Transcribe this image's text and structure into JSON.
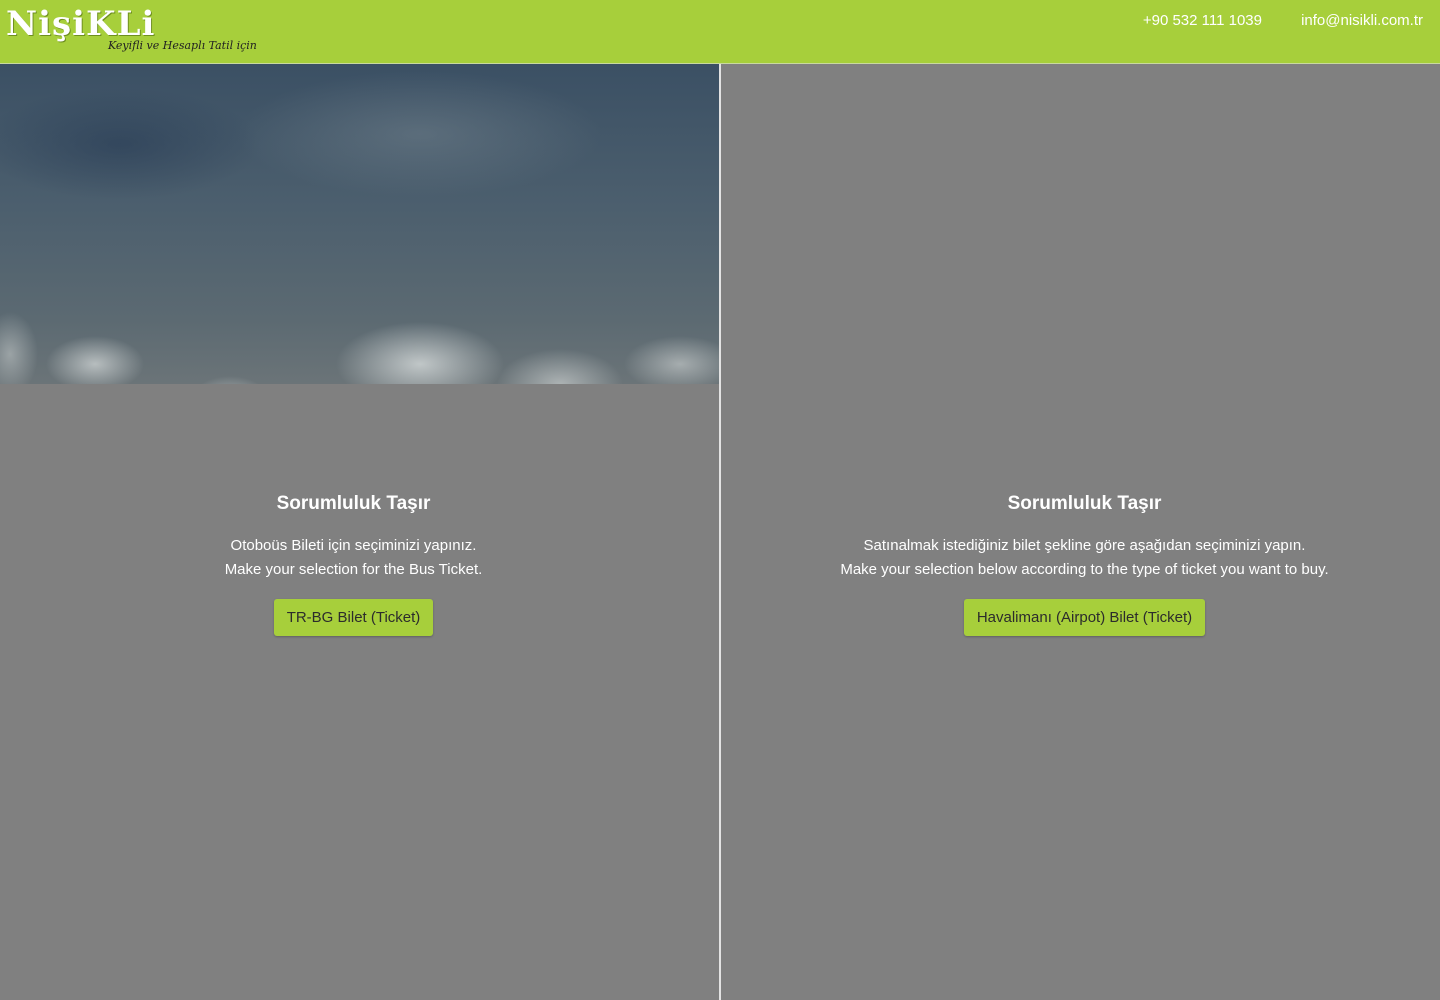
{
  "header": {
    "logo_text": "NişiKLi",
    "logo_tagline": "Keyifli ve Hesaplı Tatil için",
    "phone": "+90 532 111 1039",
    "email": "info@nisikli.com.tr",
    "background_color": "#a7cf3b"
  },
  "panels": [
    {
      "title": "Sorumluluk Taşır",
      "description_tr": "Otoboüs Bileti için seçiminizi yapınız.",
      "description_en": "Make your selection for the Bus Ticket.",
      "button_label": "TR-BG Bilet (Ticket)"
    },
    {
      "title": "Sorumluluk Taşır",
      "description_tr": "Satınalmak istediğiniz bilet şekline göre aşağıdan seçiminizi yapın.",
      "description_en": "Make your selection below according to the type of ticket you want to buy.",
      "button_label": "Havalimanı (Airpot) Bilet (Ticket)"
    }
  ],
  "colors": {
    "accent": "#a7cf3b",
    "overlay": "#808080"
  }
}
